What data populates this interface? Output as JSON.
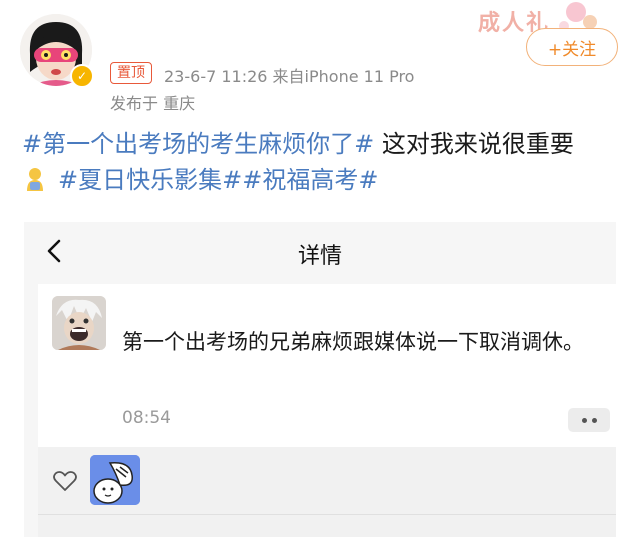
{
  "post": {
    "pin_label": "置顶",
    "time_source": "23-6-7 11:26  来自iPhone 11 Pro",
    "location": "发布于 重庆",
    "promo_text": "成人礼",
    "follow_label": "+关注",
    "hashtag_1": "#第一个出考场的考生麻烦你了#",
    "body_text": "  这对我来说很重要",
    "hashtag_2": "#夏日快乐影集#",
    "hashtag_3": "#祝福高考#"
  },
  "embedded": {
    "title": "详情",
    "comment_text": "第一个出考场的兄弟麻烦跟媒体说一下取消调休。",
    "comment_time": "08:54"
  },
  "icons": {
    "avatar": "cartoon-avatar",
    "verified": "verified-badge-icon",
    "back": "chevron-left-icon",
    "more": "more-dots-icon",
    "heart": "heart-icon"
  },
  "colors": {
    "hashtag": "#4a7bbf",
    "pin": "#e8593a",
    "follow": "#f08a2a",
    "muted": "#8a8a8a"
  }
}
